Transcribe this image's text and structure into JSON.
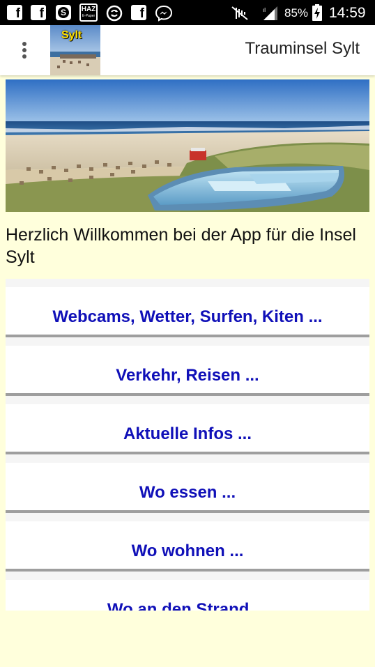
{
  "status_bar": {
    "icons": [
      "facebook-icon",
      "facebook-icon",
      "skype-icon",
      "haz-epaper-icon",
      "sync-icon",
      "facebook-icon",
      "messenger-icon",
      "mute-icon",
      "signal-icon",
      "battery-charging-icon"
    ],
    "haz_label": "HAZ",
    "haz_sublabel": "E-Paper",
    "battery": "85%",
    "time": "14:59"
  },
  "app_bar": {
    "logo_label": "Sylt",
    "title": "Trauminsel Sylt"
  },
  "welcome_text": "Herzlich Willkommen bei der App für die Insel Sylt",
  "menu": [
    {
      "label": "Webcams, Wetter, Surfen, Kiten ..."
    },
    {
      "label": "Verkehr, Reisen ..."
    },
    {
      "label": "Aktuelle Infos ..."
    },
    {
      "label": "Wo essen ..."
    },
    {
      "label": "Wo wohnen ..."
    },
    {
      "label": "Wo an den Strand ..."
    }
  ],
  "colors": {
    "background": "#ffffdc",
    "button_text": "#1010b8",
    "status_bar": "#000000"
  }
}
